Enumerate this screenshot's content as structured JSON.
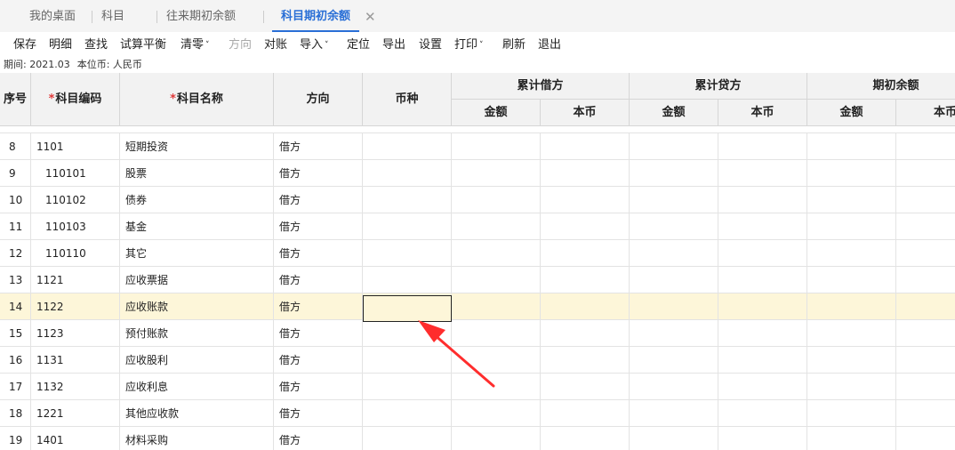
{
  "tabs": [
    {
      "label": "我的桌面"
    },
    {
      "label": "科目"
    },
    {
      "label": "往来期初余额"
    },
    {
      "label": "科目期初余额",
      "close": "✕"
    }
  ],
  "toolbar": [
    {
      "label": "保存"
    },
    {
      "label": "明细"
    },
    {
      "label": "查找"
    },
    {
      "label": "试算平衡"
    },
    {
      "label": "清零",
      "caret": "˅"
    },
    {
      "label": "方向"
    },
    {
      "label": "对账"
    },
    {
      "label": "导入",
      "caret": "˅"
    },
    {
      "label": "定位"
    },
    {
      "label": "导出"
    },
    {
      "label": "设置"
    },
    {
      "label": "打印",
      "caret": "˅"
    },
    {
      "label": "刷新"
    },
    {
      "label": "退出"
    }
  ],
  "info": {
    "period": "期间: 2021.03",
    "currency": "本位币: 人民币"
  },
  "grid": {
    "required_mark": "*",
    "headers": {
      "seq": "序号",
      "code": "科目编码",
      "name": "科目名称",
      "direction": "方向",
      "currency": "币种",
      "debit": "累计借方",
      "credit": "累计贷方",
      "balance": "期初余额",
      "amount": "金额",
      "base": "本币"
    },
    "rows": [
      {
        "seq": "8",
        "code": "1101",
        "name": "短期投资",
        "direction": "借方"
      },
      {
        "seq": "9",
        "code": "110101",
        "name": "股票",
        "direction": "借方",
        "indent": true
      },
      {
        "seq": "10",
        "code": "110102",
        "name": "债券",
        "direction": "借方",
        "indent": true
      },
      {
        "seq": "11",
        "code": "110103",
        "name": "基金",
        "direction": "借方",
        "indent": true
      },
      {
        "seq": "12",
        "code": "110110",
        "name": "其它",
        "direction": "借方",
        "indent": true
      },
      {
        "seq": "13",
        "code": "1121",
        "name": "应收票据",
        "direction": "借方"
      },
      {
        "seq": "14",
        "code": "1122",
        "name": "应收账款",
        "direction": "借方",
        "highlighted": true
      },
      {
        "seq": "15",
        "code": "1123",
        "name": "预付账款",
        "direction": "借方"
      },
      {
        "seq": "16",
        "code": "1131",
        "name": "应收股利",
        "direction": "借方"
      },
      {
        "seq": "17",
        "code": "1132",
        "name": "应收利息",
        "direction": "借方"
      },
      {
        "seq": "18",
        "code": "1221",
        "name": "其他应收款",
        "direction": "借方"
      },
      {
        "seq": "19",
        "code": "1401",
        "name": "材料采购",
        "direction": "借方"
      }
    ]
  },
  "colors": {
    "accent": "#2a6fd6",
    "highlight": "#fdf6d9",
    "arrow": "#ff2d2d",
    "required": "#e03a3a"
  }
}
